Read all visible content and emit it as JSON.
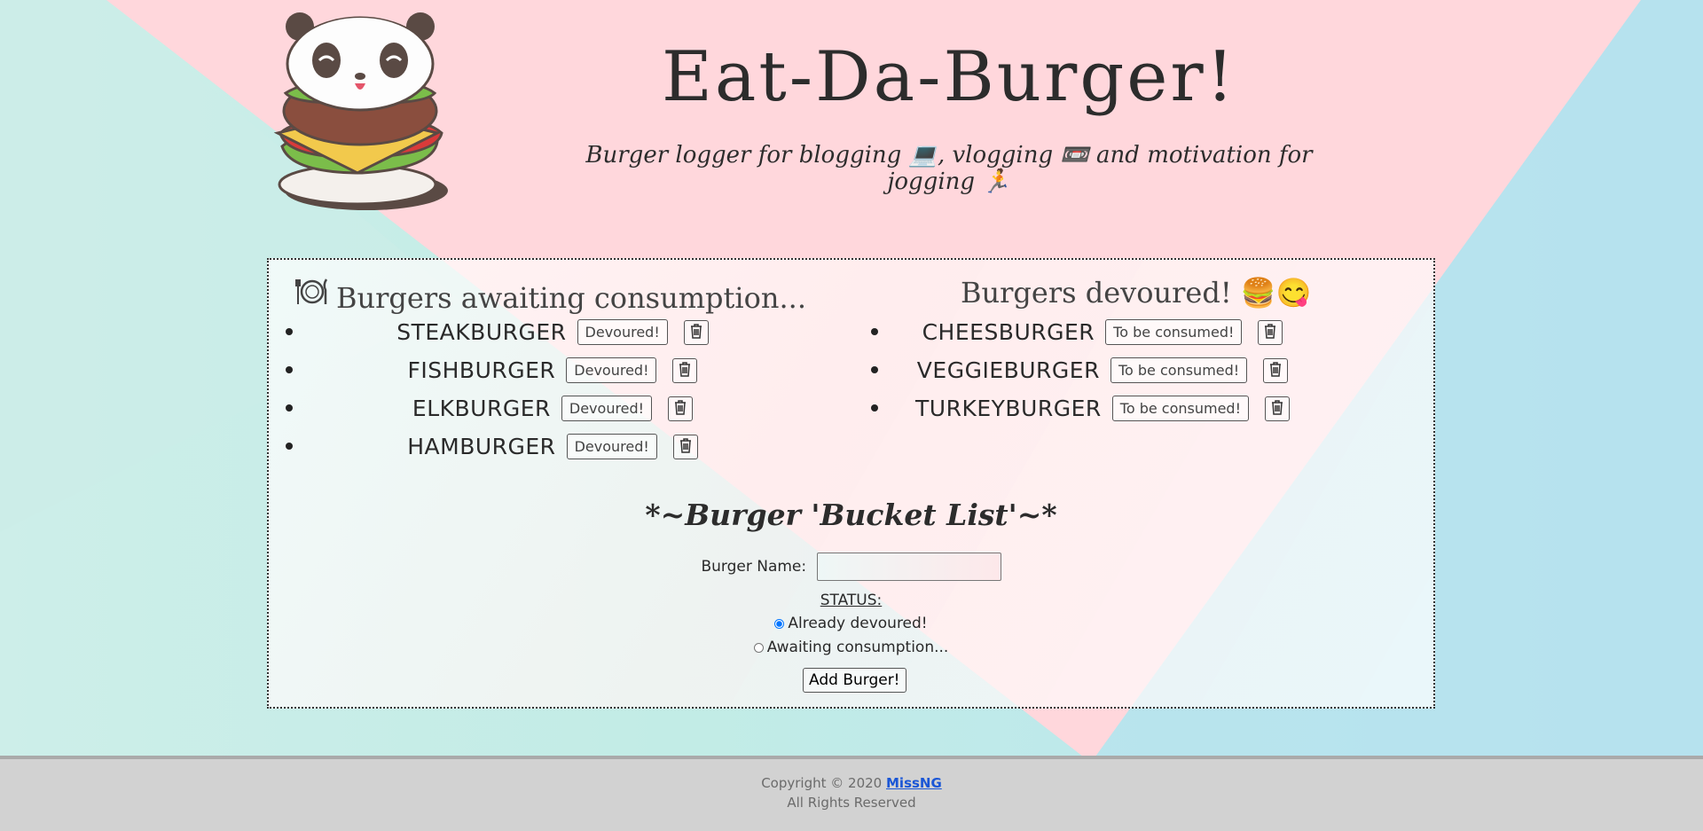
{
  "header": {
    "title": "Eat-Da-Burger!",
    "subtitle": "Burger logger for blogging 💻, vlogging 📼 and motivation for jogging 🏃"
  },
  "awaiting": {
    "heading": "Burgers awaiting consumption...",
    "heading_icon": "fork-knife-plate-icon",
    "action_label": "Devoured!",
    "items": [
      {
        "name": "STEAKBURGER"
      },
      {
        "name": "FISHBURGER"
      },
      {
        "name": "ELKBURGER"
      },
      {
        "name": "HAMBURGER"
      }
    ]
  },
  "devoured": {
    "heading": "Burgers devoured! 🍔😋",
    "action_label": "To be consumed!",
    "items": [
      {
        "name": "CHEESBURGER"
      },
      {
        "name": "VEGGIEBURGER"
      },
      {
        "name": "TURKEYBURGER"
      }
    ]
  },
  "form": {
    "title": "*~Burger 'Bucket List'~*",
    "name_label": "Burger Name:",
    "name_value": "",
    "status_label": "STATUS:",
    "option_devoured": "Already devoured!",
    "option_awaiting": "Awaiting consumption...",
    "selected": "devoured",
    "submit_label": "Add Burger!"
  },
  "footer": {
    "copyright": "Copyright © 2020",
    "author_link": "MissNG",
    "rights": "All Rights Reserved"
  },
  "colors": {
    "pink_triangle": "#ffd6dc",
    "footer_bg": "#d2d2d2",
    "link": "#1a56d6"
  }
}
